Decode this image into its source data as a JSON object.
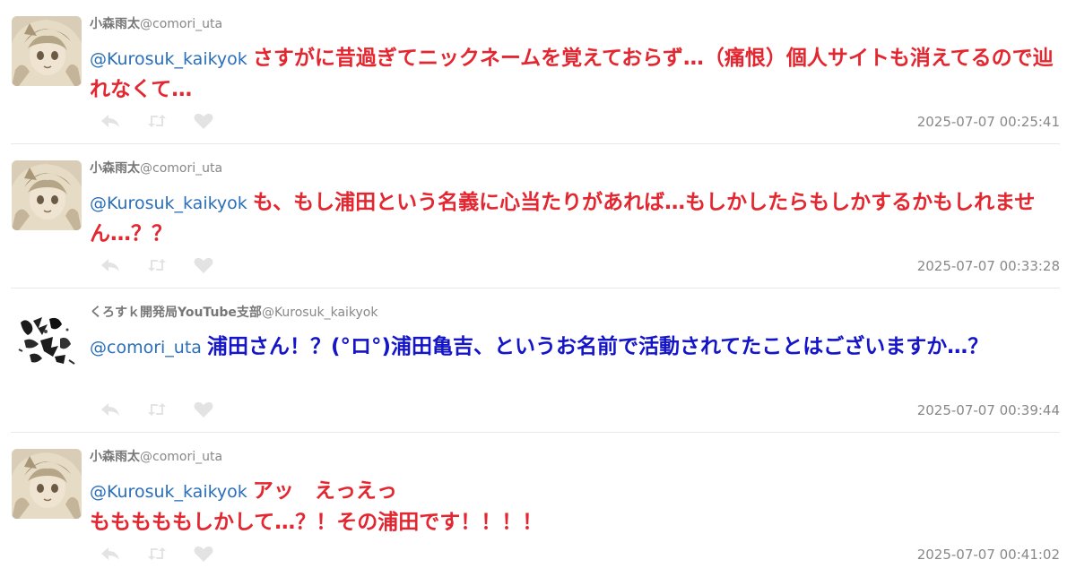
{
  "tweets": [
    {
      "avatar": "anime-girl-avatar",
      "name": "小森雨太",
      "handle": "@comori_uta",
      "mention": "@Kurosuk_kaikyok",
      "text": "さすがに昔過ぎてニックネームを覚えておらず…（痛恨）個人サイトも消えてるので辿れなくて…",
      "color": "#e3262f",
      "timestamp": "2025-07-07 00:25:41"
    },
    {
      "avatar": "anime-girl-avatar",
      "name": "小森雨太",
      "handle": "@comori_uta",
      "mention": "@Kurosuk_kaikyok",
      "text": "も、もし浦田という名義に心当たりがあれば…もしかしたらもしかするかもしれません…？？",
      "color": "#e3262f",
      "timestamp": "2025-07-07 00:33:28"
    },
    {
      "avatar": "ink-calligraphy-avatar",
      "name": "くろすｋ開発局YouTube支部",
      "handle": "@Kurosuk_kaikyok",
      "mention": "@comori_uta",
      "text": "浦田さん！？(°ロ°)浦田亀吉、というお名前で活動されてたことはございますか…？",
      "color": "#1414c8",
      "timestamp": "2025-07-07 00:39:44"
    },
    {
      "avatar": "anime-girl-avatar",
      "name": "小森雨太",
      "handle": "@comori_uta",
      "mention": "@Kurosuk_kaikyok",
      "text": "アッ　えっえっ",
      "text2": "もももももしかして…？！その浦田です！！！！",
      "color": "#e3262f",
      "timestamp": "2025-07-07 00:41:02"
    }
  ],
  "actions": {
    "reply_icon": "reply-icon",
    "retweet_icon": "retweet-icon",
    "like_icon": "heart-icon"
  }
}
